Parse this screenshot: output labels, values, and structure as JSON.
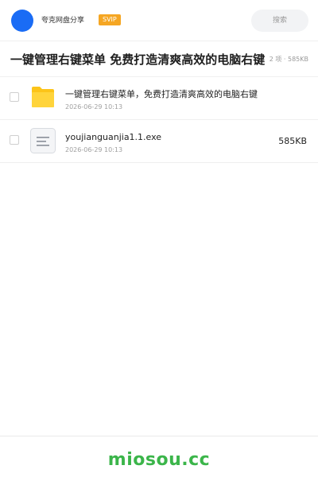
{
  "header": {
    "brand": "夸克网盘分享",
    "badge": "SVIP",
    "search_placeholder": "搜索",
    "accent_color": "#1a6cf5"
  },
  "share": {
    "title": "一键管理右键菜单 免费打造清爽高效的电脑右键",
    "meta": "2 项 · 585KB"
  },
  "files": [
    {
      "name": "一键管理右键菜单，免费打造清爽高效的电脑右键",
      "date": "2026-06-29 10:13",
      "size": "",
      "icon": "folder-icon"
    },
    {
      "name": "youjianguanjia1.1.exe",
      "date": "2026-06-29 10:13",
      "size": "585KB",
      "icon": "file-document-icon"
    }
  ],
  "footer": {
    "logo": "miosou.cc",
    "logo_color": "#3bb54a"
  }
}
